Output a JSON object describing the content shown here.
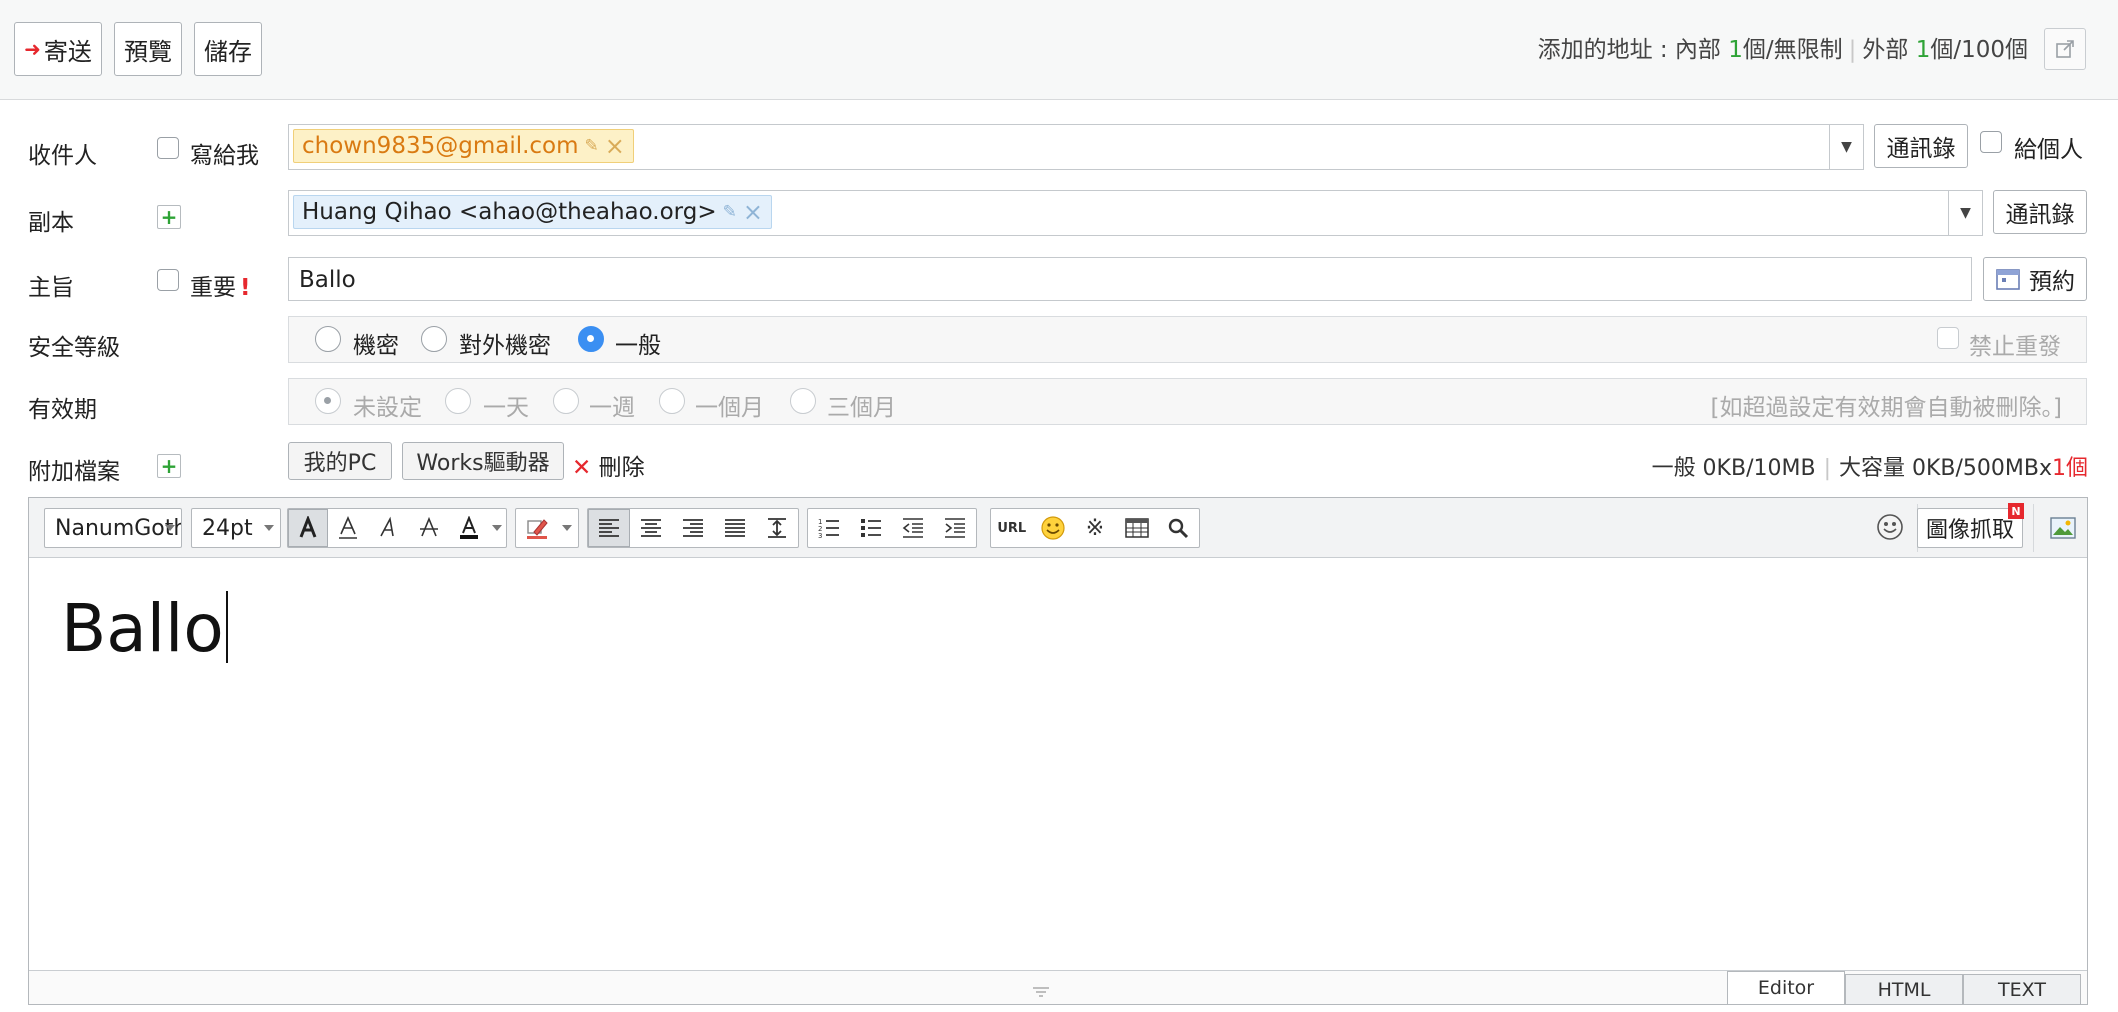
{
  "toolbar": {
    "send_label": "寄送",
    "preview_label": "預覽",
    "save_label": "儲存",
    "addr_prefix": "添加的地址 : 內部 ",
    "internal_count": "1",
    "internal_suffix": "個/無限制",
    "separator": "|",
    "external_prefix": "外部 ",
    "external_count": "1",
    "external_suffix": "個/100個"
  },
  "recipient": {
    "label": "收件人",
    "write_to_me": "寫給我",
    "tag_email": "chown9835@gmail.com",
    "address_book": "通訊錄",
    "individual": "給個人"
  },
  "cc": {
    "label": "副本",
    "tag_text": "Huang Qihao <ahao@theahao.org>",
    "address_book": "通訊錄"
  },
  "subject": {
    "label": "主旨",
    "important": "重要",
    "important_mark": "!",
    "value": "Ballo",
    "schedule": "預約"
  },
  "security": {
    "label": "安全等級",
    "options": [
      "機密",
      "對外機密",
      "一般"
    ],
    "selected": "一般",
    "forward_block": "禁止重發"
  },
  "validity": {
    "label": "有效期",
    "options": [
      "未設定",
      "一天",
      "一週",
      "一個月",
      "三個月"
    ],
    "selected": "未設定",
    "note": "[如超過設定有效期會自動被刪除。]"
  },
  "attachment": {
    "label": "附加檔案",
    "my_pc": "我的PC",
    "works_drive": "Works驅動器",
    "delete": "刪除",
    "normal_size": "一般 0KB/10MB",
    "large_size_prefix": "大容量 0KB/500MBx",
    "large_count": "1個"
  },
  "editor": {
    "font_family": "NanumGothic",
    "font_size": "24pt",
    "capture": "圖像抓取",
    "capture_badge": "N",
    "url": "URL",
    "body": "Ballo",
    "tabs": [
      "Editor",
      "HTML",
      "TEXT"
    ],
    "active_tab": "Editor"
  },
  "colors": {
    "accent_green": "#2ea336",
    "accent_red": "#e6282e",
    "radio_blue": "#3b8ff2",
    "to_tag_bg": "#fdf1c7",
    "cc_tag_bg": "#e4f0fb"
  }
}
